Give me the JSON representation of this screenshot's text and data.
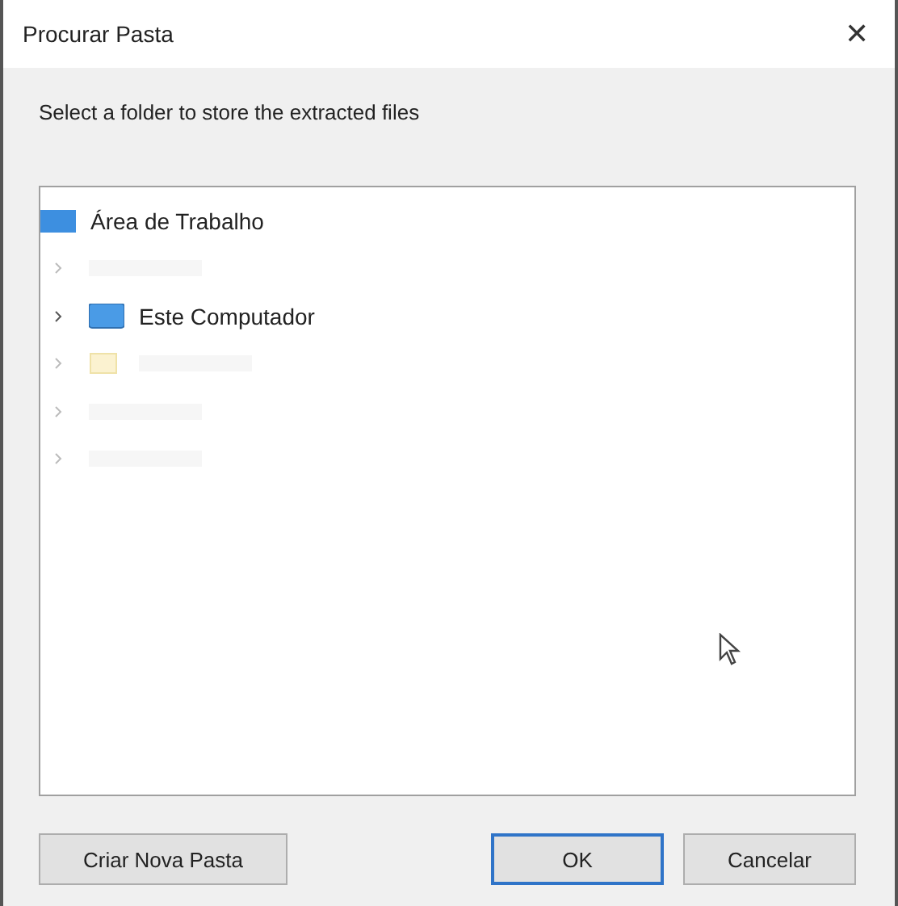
{
  "window": {
    "title": "Procurar Pasta",
    "close": "✕"
  },
  "prompt": "Select a folder to store the extracted files",
  "tree": {
    "root": {
      "label": "Área de Trabalho",
      "kind": "desktop",
      "children": [
        {
          "kind": "blurred",
          "expanded": false
        },
        {
          "kind": "computer",
          "label": "Este Computador",
          "expanded": false
        },
        {
          "kind": "blurred-folder",
          "expanded": false
        },
        {
          "kind": "blurred",
          "expanded": false
        },
        {
          "kind": "blurred",
          "expanded": false
        }
      ]
    }
  },
  "buttons": {
    "left": "Criar Nova Pasta",
    "ok": "OK",
    "cancel": "Cancelar"
  }
}
